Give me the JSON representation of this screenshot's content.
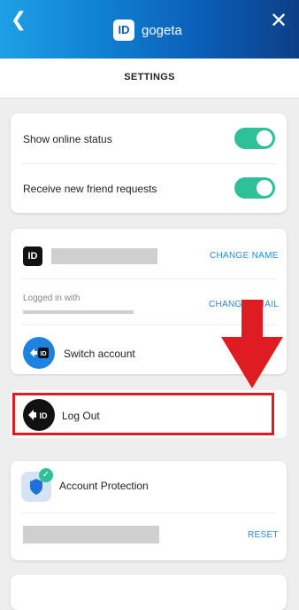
{
  "header": {
    "back_icon": "chevron-left-icon",
    "close_icon": "close-icon",
    "logo_text": "ID",
    "app_name": "gogeta"
  },
  "subbar": {
    "title": "SETTINGS"
  },
  "status_card": {
    "show_online_status_label": "Show online status",
    "show_online_status_on": true,
    "friend_requests_label": "Receive new friend requests",
    "friend_requests_on": true
  },
  "account_card": {
    "id_icon_text": "ID",
    "change_name_label": "CHANGE NAME",
    "logged_in_with_label": "Logged in with",
    "change_email_label": "CHANGE EMAIL",
    "switch_account_label": "Switch account",
    "switch_icon_text": "ID"
  },
  "logout": {
    "label": "Log Out",
    "icon_text": "ID"
  },
  "protection_card": {
    "label": "Account Protection",
    "reset_label": "RESET"
  },
  "colors": {
    "toggle_on": "#2ec098",
    "link": "#2a8ad6",
    "highlight": "#e01c23"
  }
}
